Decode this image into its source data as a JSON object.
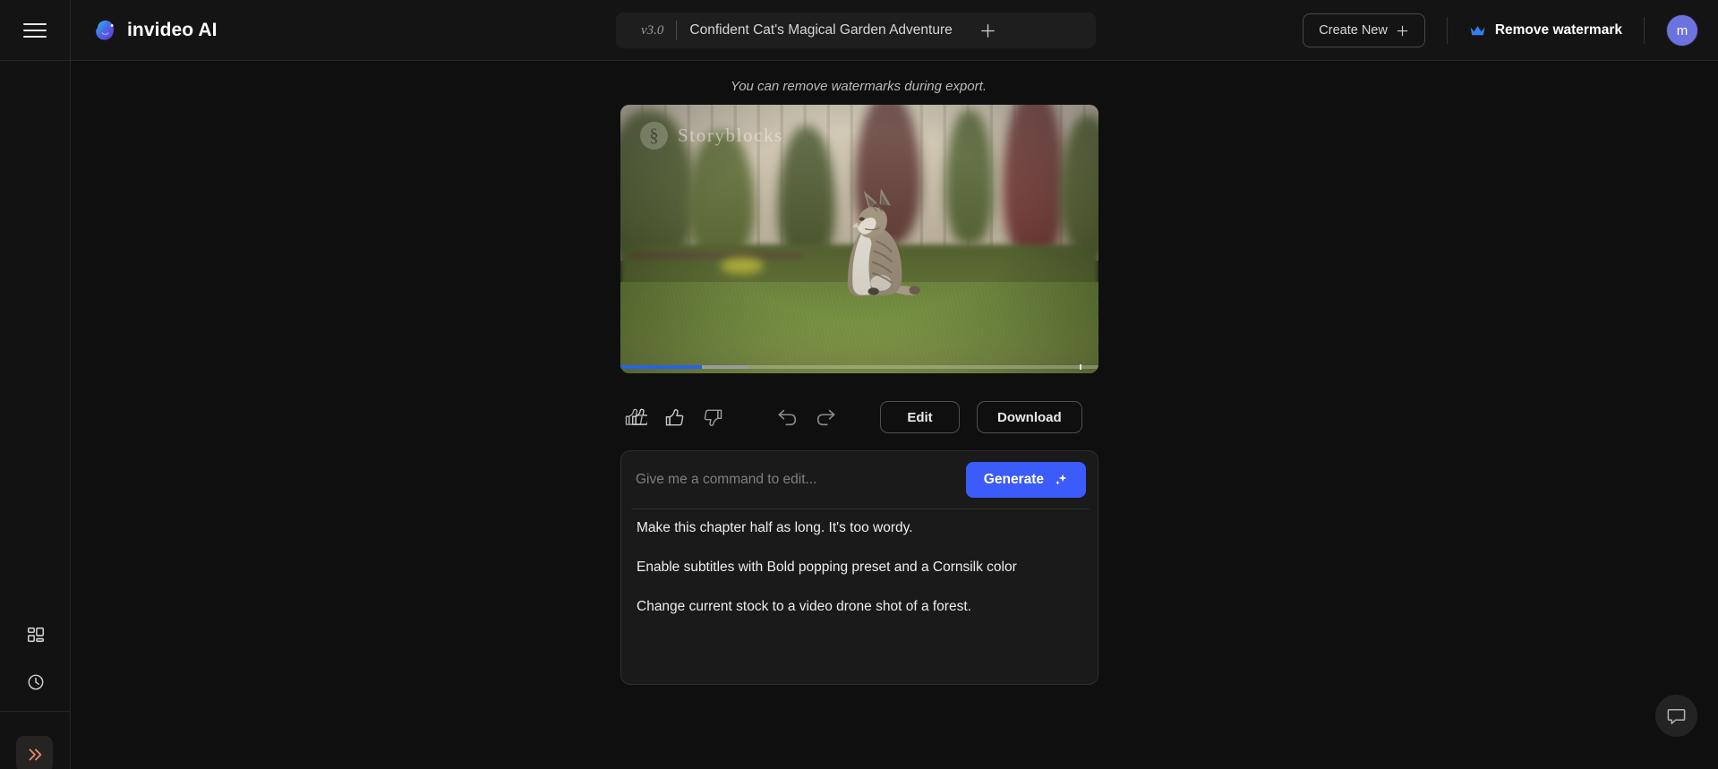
{
  "app": {
    "brand_name": "invideo AI",
    "brand_logo_icon": "invideo-blob-logo"
  },
  "topbar": {
    "menu_icon": "hamburger-menu-icon",
    "project": {
      "version": "v3.0",
      "title": "Confident Cat's Magical Garden Adventure",
      "add_icon": "plus-icon"
    },
    "create_new_label": "Create New",
    "create_new_icon": "plus-icon",
    "remove_watermark_label": "Remove watermark",
    "crown_icon": "crown-icon",
    "avatar_initial": "m"
  },
  "sidebar": {
    "items": [
      {
        "name": "dashboard",
        "icon": "grid-dashboard-icon"
      },
      {
        "name": "history",
        "icon": "clock-history-icon"
      }
    ],
    "expand_icon": "double-chevron-right-icon"
  },
  "main": {
    "watermark_note": "You can remove watermarks during export.",
    "video": {
      "stock_watermark_text": "Storyblocks",
      "stock_watermark_icon": "storyblocks-logo-icon",
      "scene_description": "Grey and white cat sitting on sunlit green lawn in a garden",
      "progress_played_percent": 17,
      "progress_buffered_percent": 27,
      "chapter_marker_percent": 96
    },
    "actions": {
      "thumbs_up_double_icon": "double-thumbs-up-icon",
      "thumbs_up_icon": "thumbs-up-icon",
      "thumbs_down_icon": "thumbs-down-icon",
      "undo_icon": "undo-arrow-icon",
      "redo_icon": "redo-arrow-icon",
      "edit_label": "Edit",
      "download_label": "Download"
    },
    "command": {
      "input_value": "",
      "input_placeholder": "Give me a command to edit...",
      "generate_label": "Generate",
      "generate_icon": "sparkle-icon",
      "suggestions": [
        "Make this chapter half as long. It's too wordy.",
        "Enable subtitles with Bold popping preset and a Cornsilk color",
        "Change current stock to a video drone shot of a forest."
      ]
    },
    "chat_fab_icon": "chat-bubble-icon"
  },
  "colors": {
    "page_background": "#0f0f0f",
    "topbar_background": "#141414",
    "panel_background": "#1a1a1a",
    "accent_generate": "#3b5bfb",
    "accent_progress": "#2563eb",
    "accent_avatar": "#6c72e0",
    "accent_expand": "#e08b72",
    "crown_blue": "#2f7ff0"
  }
}
